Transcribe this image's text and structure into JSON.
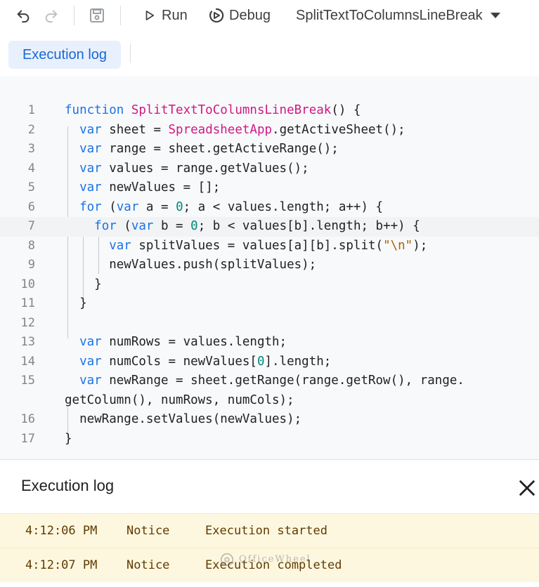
{
  "toolbar": {
    "undo_icon": "undo-icon",
    "redo_icon": "redo-icon",
    "save_icon": "save-icon",
    "run_label": "Run",
    "debug_label": "Debug",
    "function_select": "SplitTextToColumnsLineBreak"
  },
  "tabs": {
    "execution_log": "Execution log"
  },
  "editor": {
    "lines": [
      {
        "n": "1",
        "tokens": [
          [
            "kw",
            "function "
          ],
          [
            "fn",
            "SplitTextToColumnsLineBreak"
          ],
          [
            "",
            "() {"
          ]
        ]
      },
      {
        "n": "2",
        "tokens": [
          [
            "",
            "  "
          ],
          [
            "kw",
            "var"
          ],
          [
            "",
            " sheet = "
          ],
          [
            "fn",
            "SpreadsheetApp"
          ],
          [
            "",
            ".getActiveSheet();"
          ]
        ]
      },
      {
        "n": "3",
        "tokens": [
          [
            "",
            "  "
          ],
          [
            "kw",
            "var"
          ],
          [
            "",
            " range = sheet.getActiveRange();"
          ]
        ]
      },
      {
        "n": "4",
        "tokens": [
          [
            "",
            "  "
          ],
          [
            "kw",
            "var"
          ],
          [
            "",
            " values = range.getValues();"
          ]
        ]
      },
      {
        "n": "5",
        "tokens": [
          [
            "",
            "  "
          ],
          [
            "kw",
            "var"
          ],
          [
            "",
            " newValues = [];"
          ]
        ]
      },
      {
        "n": "6",
        "tokens": [
          [
            "",
            "  "
          ],
          [
            "kw",
            "for"
          ],
          [
            "",
            " ("
          ],
          [
            "kw",
            "var"
          ],
          [
            "",
            " a = "
          ],
          [
            "num",
            "0"
          ],
          [
            "",
            "; a < values.length; a++) {"
          ]
        ]
      },
      {
        "n": "7",
        "tokens": [
          [
            "",
            "    "
          ],
          [
            "kw",
            "for"
          ],
          [
            "",
            " ("
          ],
          [
            "kw",
            "var"
          ],
          [
            "",
            " b = "
          ],
          [
            "num",
            "0"
          ],
          [
            "",
            "; b < values[b].length; b++) {"
          ]
        ]
      },
      {
        "n": "8",
        "tokens": [
          [
            "",
            "      "
          ],
          [
            "kw",
            "var"
          ],
          [
            "",
            " splitValues = values[a][b].split("
          ],
          [
            "str",
            "\"\\n\""
          ],
          [
            "",
            ");"
          ]
        ]
      },
      {
        "n": "9",
        "tokens": [
          [
            "",
            "      newValues.push(splitValues);"
          ]
        ]
      },
      {
        "n": "10",
        "tokens": [
          [
            "",
            "    }"
          ]
        ]
      },
      {
        "n": "11",
        "tokens": [
          [
            "",
            "  }"
          ]
        ]
      },
      {
        "n": "12",
        "tokens": []
      },
      {
        "n": "13",
        "tokens": [
          [
            "",
            "  "
          ],
          [
            "kw",
            "var"
          ],
          [
            "",
            " numRows = values.length;"
          ]
        ]
      },
      {
        "n": "14",
        "tokens": [
          [
            "",
            "  "
          ],
          [
            "kw",
            "var"
          ],
          [
            "",
            " numCols = newValues["
          ],
          [
            "num",
            "0"
          ],
          [
            "",
            "].length;"
          ]
        ]
      },
      {
        "n": "15",
        "tokens": [
          [
            "",
            "  "
          ],
          [
            "kw",
            "var"
          ],
          [
            "",
            " newRange = sheet.getRange(range.getRow(), range."
          ]
        ]
      },
      {
        "n": "",
        "tokens": [
          [
            "",
            "getColumn(), numRows, numCols);"
          ]
        ]
      },
      {
        "n": "16",
        "tokens": [
          [
            "",
            "  newRange.setValues(newValues);"
          ]
        ]
      },
      {
        "n": "17",
        "tokens": [
          [
            "",
            "}"
          ]
        ]
      }
    ]
  },
  "log": {
    "title": "Execution log",
    "close_icon": "close-icon",
    "rows": [
      {
        "time": "4:12:06 PM",
        "level": "Notice",
        "message": "Execution started"
      },
      {
        "time": "4:12:07 PM",
        "level": "Notice",
        "message": "Execution completed"
      }
    ]
  },
  "watermark": "OfficeWheel"
}
